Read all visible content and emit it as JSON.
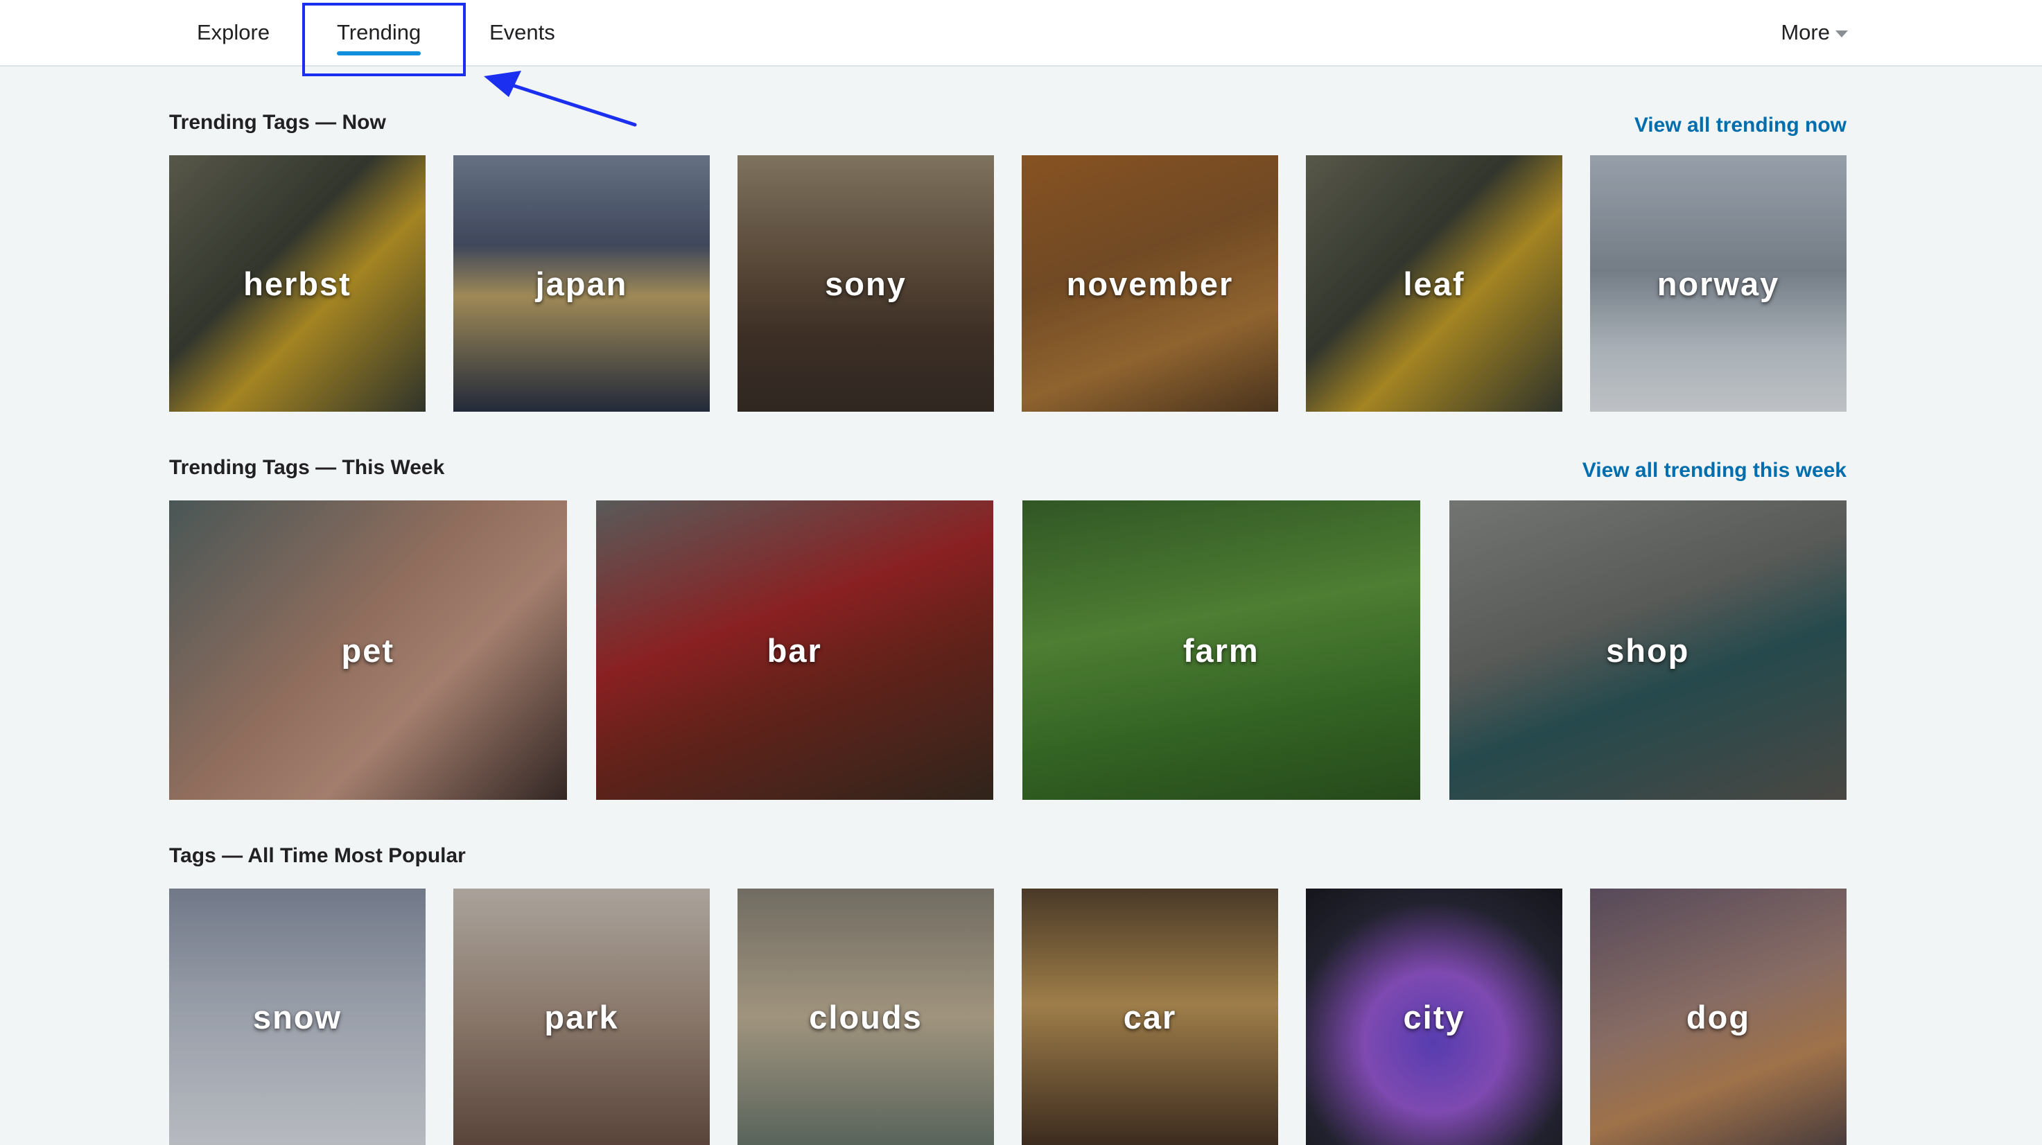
{
  "nav": {
    "tabs": [
      {
        "label": "Explore"
      },
      {
        "label": "Trending"
      },
      {
        "label": "Events"
      }
    ],
    "active_tab": "Trending",
    "more_label": "More"
  },
  "colors": {
    "accent": "#128fdc",
    "link": "#006dac",
    "annotation": "#1a2ff0"
  },
  "sections": {
    "now": {
      "title": "Trending Tags — Now",
      "link": "View all trending now",
      "tags": [
        {
          "label": "herbst",
          "bg": "linear-gradient(135deg,#6b6b5a 0%,#3d4236 40%,#c9a22a 60%,#3a3f33 100%)"
        },
        {
          "label": "japan",
          "bg": "linear-gradient(180deg,#7c8aa0 0%,#4d5770 35%,#c2a86a 55%,#2a3347 100%)"
        },
        {
          "label": "sony",
          "bg": "linear-gradient(180deg,#9a8c74 0%,#6e5b46 40%,#4b3a2e 70%,#3a3029 100%)"
        },
        {
          "label": "november",
          "bg": "linear-gradient(160deg,#a5652a 0%,#8a5a2c 40%,#b07a3a 70%,#5a3f24 100%)"
        },
        {
          "label": "leaf",
          "bg": "linear-gradient(135deg,#6b6b5a 0%,#3d4236 40%,#c9a22a 60%,#3a3f33 100%)"
        },
        {
          "label": "norway",
          "bg": "linear-gradient(180deg,#b8c3cf 0%,#8e98a4 45%,#cdd6de 75%,#e7ecf0 100%)"
        }
      ]
    },
    "week": {
      "title": "Trending Tags — This Week",
      "link": "View all trending this week",
      "tags": [
        {
          "label": "pet",
          "bg": "linear-gradient(135deg,#5a6a6a 0%,#b08672 45%,#c79a86 65%,#3e2f2c 100%)"
        },
        {
          "label": "bar",
          "bg": "linear-gradient(160deg,#6d6f6e 0%,#a8282a 40%,#7a2a20 60%,#3a2d22 100%)"
        },
        {
          "label": "farm",
          "bg": "linear-gradient(170deg,#3c6a2e 0%,#5f9a3e 40%,#3f7a2c 70%,#2f5a22 100%)"
        },
        {
          "label": "shop",
          "bg": "linear-gradient(160deg,#8c8f8c 0%,#6b6e6a 40%,#2e5a5e 60%,#5a5752 100%)"
        }
      ]
    },
    "alltime": {
      "title": "Tags — All Time Most Popular",
      "tags": [
        {
          "label": "snow",
          "bg": "linear-gradient(180deg,#8a93a6 0%,#b9c0cd 45%,#dfe3ea 100%)"
        },
        {
          "label": "park",
          "bg": "linear-gradient(180deg,#cfc7bd 0%,#a89282 50%,#6e5448 100%)"
        },
        {
          "label": "clouds",
          "bg": "linear-gradient(180deg,#8a8478 0%,#c4b59a 50%,#6d7a70 100%)"
        },
        {
          "label": "car",
          "bg": "linear-gradient(180deg,#5a4630 0%,#c29a5a 45%,#4a3526 100%)"
        },
        {
          "label": "city",
          "bg": "radial-gradient(circle at 50% 60%,#6a4ad6 0%,#9b5ad8 35%,#2a2a3a 70%,#1a1a22 100%)"
        },
        {
          "label": "dog",
          "bg": "linear-gradient(160deg,#6a5a6e 0%,#a5847a 45%,#c28b5a 70%,#5a4a4a 100%)"
        }
      ]
    }
  }
}
